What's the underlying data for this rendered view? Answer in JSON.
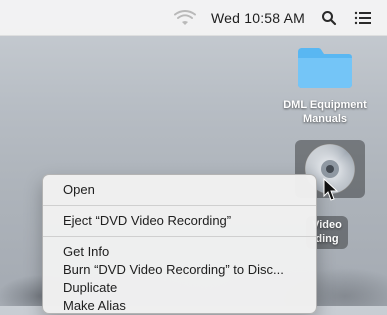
{
  "menubar": {
    "clock": "Wed 10:58 AM"
  },
  "desktop": {
    "folder": {
      "label": "DML Equipment Manuals"
    },
    "dvd": {
      "label_visible": "Video\nding"
    }
  },
  "context_menu": {
    "items": [
      {
        "label": "Open"
      },
      {
        "label": "Eject “DVD Video Recording”"
      },
      {
        "label": "Get Info"
      },
      {
        "label": "Burn “DVD Video Recording” to Disc..."
      },
      {
        "label": "Duplicate"
      },
      {
        "label": "Make Alias"
      }
    ]
  },
  "colors": {
    "menubar_bg": "#f5f5f5",
    "folder_blue": "#5bb6f0",
    "menu_bg": "#f0f0f0"
  },
  "icons": {
    "wifi": "wifi-icon",
    "search": "search-icon",
    "notification_center": "list-icon",
    "folder": "folder-icon",
    "dvd": "dvd-disc-icon",
    "cursor": "arrow-cursor-icon"
  }
}
